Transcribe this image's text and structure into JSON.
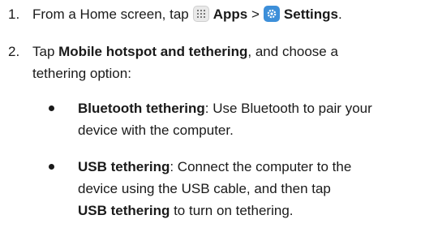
{
  "steps": [
    {
      "number": "1.",
      "prefix": "From a Home screen, tap",
      "apps_label": "Apps",
      "separator": ">",
      "settings_label": "Settings",
      "suffix": "."
    },
    {
      "number": "2.",
      "prefix": "Tap ",
      "bold": "Mobile hotspot and tethering",
      "suffix": ", and choose a",
      "line2": "tethering option:"
    }
  ],
  "options": [
    {
      "title": "Bluetooth tethering",
      "line1_rest": ": Use Bluetooth to pair your",
      "line2": "device with the computer."
    },
    {
      "title": "USB tethering",
      "line1_rest": ": Connect the computer to the",
      "line2": "device using the USB cable, and then tap",
      "line3_bold": "USB tethering",
      "line3_rest": " to turn on tethering."
    }
  ],
  "icons": {
    "apps": "apps-grid-icon",
    "settings": "settings-gear-icon"
  },
  "colors": {
    "text": "#1a1a1a",
    "settings_icon": "#3d8fd9",
    "apps_icon": "#e9e9e9"
  }
}
